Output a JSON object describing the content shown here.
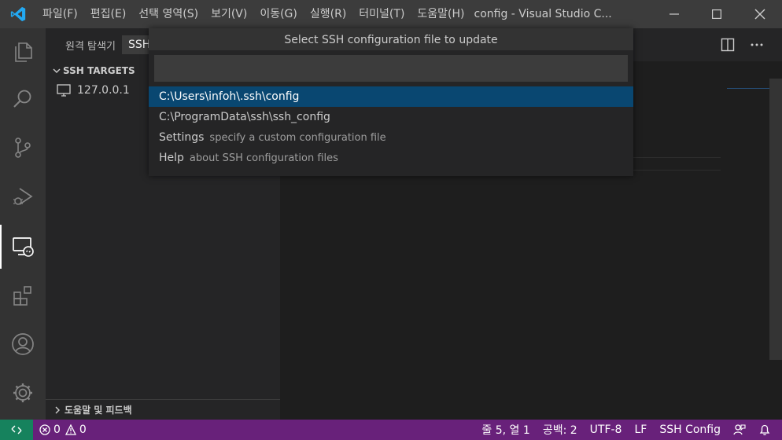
{
  "titlebar": {
    "menus": [
      "파일(F)",
      "편집(E)",
      "선택 영역(S)",
      "보기(V)",
      "이동(G)",
      "실행(R)",
      "터미널(T)",
      "도움말(H)"
    ],
    "window_title": "config - Visual Studio C..."
  },
  "sidebar": {
    "title": "원격 탐색기",
    "dropdown_value": "SSH",
    "section_title": "SSH TARGETS",
    "targets": [
      "127.0.0.1"
    ],
    "help_section": "도움말 및 피드백"
  },
  "quickpick": {
    "title": "Select SSH configuration file to update",
    "input_value": "",
    "items": [
      {
        "label": "C:\\Users\\infoh\\.ssh\\config",
        "description": ""
      },
      {
        "label": "C:\\ProgramData\\ssh\\ssh_config",
        "description": ""
      },
      {
        "label": "Settings",
        "description": "specify a custom configuration file"
      },
      {
        "label": "Help",
        "description": "about SSH configuration files"
      }
    ]
  },
  "statusbar": {
    "errors": "0",
    "warnings": "0",
    "position": "줄 5, 열 1",
    "indent": "공백: 2",
    "encoding": "UTF-8",
    "eol": "LF",
    "language": "SSH Config"
  },
  "colors": {
    "statusbar_bg": "#68217a",
    "remote_indicator_bg": "#16825d",
    "selection_bg": "#094771",
    "logo_blue": "#23a9f2"
  }
}
